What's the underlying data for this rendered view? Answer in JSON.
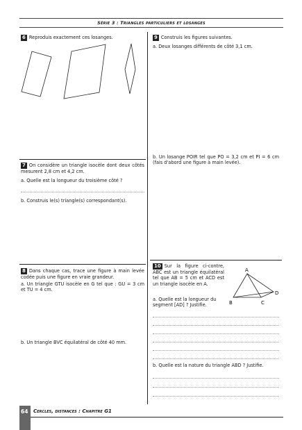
{
  "header": {
    "title": "Série 3 : Triangles particuliers et losanges"
  },
  "ex6": {
    "num": "6",
    "text": "Reproduis exactement ces losanges."
  },
  "ex9": {
    "num": "9",
    "text": "Construis les figures suivantes.",
    "a": "a. Deux losanges différents de côté 3,1 cm.",
    "b": "b. Un losange POIR tel que PO = 3,2 cm et PI = 6 cm (fais d'abord une figure à main levée)."
  },
  "ex7": {
    "num": "7",
    "text": "On considère un triangle isocèle dont deux côtés mesurent 2,8 cm et 4,2 cm.",
    "a": "a. Quelle est la longueur du troisième côté ?",
    "b": "b. Construis le(s) triangle(s) correspondant(s)."
  },
  "ex8": {
    "num": "8",
    "text": "Dans chaque cas, trace une figure à main levée codée puis une figure en vraie grandeur.",
    "a": "a. Un triangle GTU isocèle en G tel que : GU = 3 cm et TU = 4 cm.",
    "b": "b. Un triangle BVC équilatéral de côté 40 mm."
  },
  "ex10": {
    "num": "10",
    "text": "Sur la figure ci-contre, ABC est un triangle équilatéral tel que AB = 5 cm et ACD est un triangle isocèle en A.",
    "a": "a. Quelle est la longueur du segment [AD] ? Justifie.",
    "b": "b. Quelle est la nature du triangle ABD ? Justifie.",
    "labels": {
      "A": "A",
      "B": "B",
      "C": "C",
      "D": "D"
    }
  },
  "footer": {
    "page": "64",
    "title": "Cercles, distances : Chapitre G1"
  }
}
